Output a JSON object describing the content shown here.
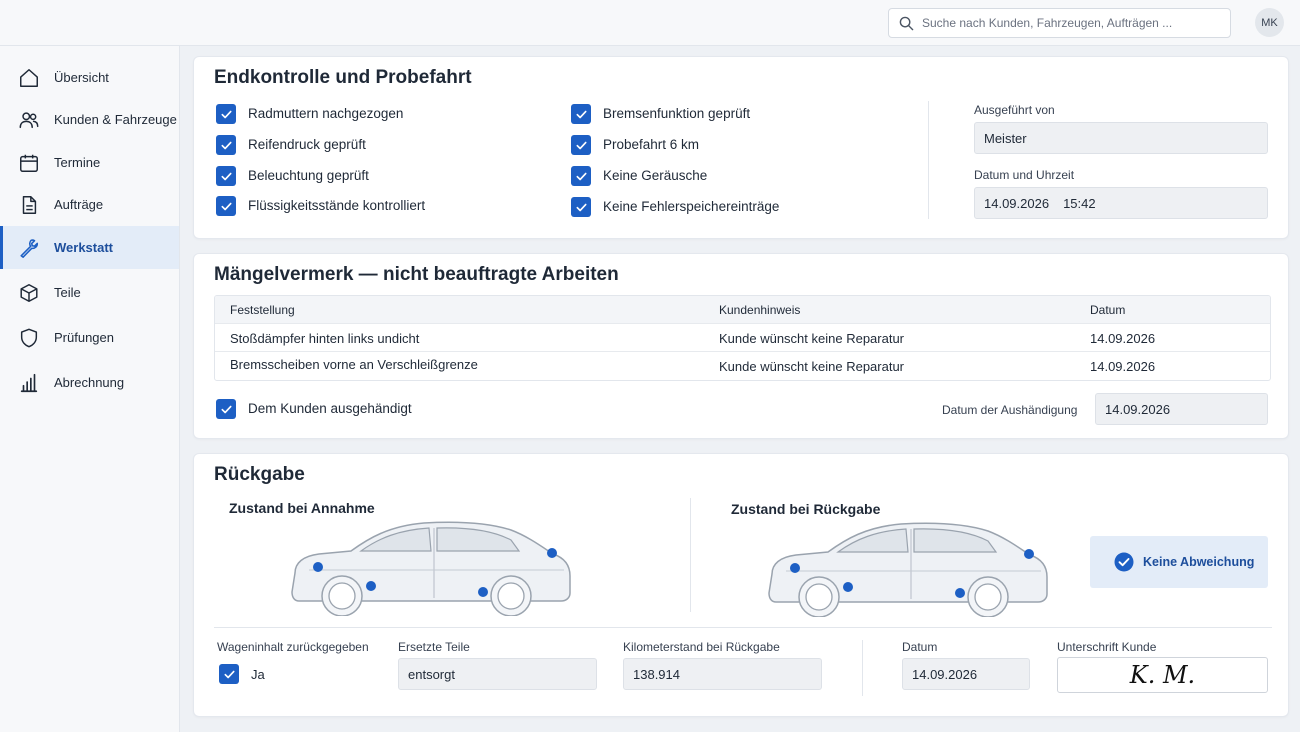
{
  "header": {
    "search_placeholder": "Suche nach Kunden, Fahrzeugen, Aufträgen ...",
    "avatar_initials": "MK"
  },
  "sidebar": {
    "items": [
      {
        "label": "Übersicht",
        "icon": "home-icon"
      },
      {
        "label": "Kunden & Fahrzeuge",
        "icon": "users-icon"
      },
      {
        "label": "Termine",
        "icon": "calendar-icon"
      },
      {
        "label": "Aufträge",
        "icon": "document-icon"
      },
      {
        "label": "Werkstatt",
        "icon": "wrench-icon",
        "active": true
      },
      {
        "label": "Teile",
        "icon": "box-icon"
      },
      {
        "label": "Prüfungen",
        "icon": "shield-icon"
      },
      {
        "label": "Abrechnung",
        "icon": "bar-chart-icon"
      }
    ]
  },
  "endkontrolle": {
    "title": "Endkontrolle und Probefahrt",
    "checks_left": [
      "Radmuttern nachgezogen",
      "Reifendruck geprüft",
      "Beleuchtung geprüft",
      "Flüssigkeitsstände kontrolliert"
    ],
    "checks_right": [
      "Bremsenfunktion geprüft",
      "Probefahrt 6 km",
      "Keine Geräusche",
      "Keine Fehlerspeichereinträge"
    ],
    "executed_by_label": "Ausgeführt von",
    "executed_by_value": "Meister",
    "datetime_label": "Datum und Uhrzeit",
    "date_value": "14.09.2026",
    "time_value": "15:42"
  },
  "maengel": {
    "title": "Mängelvermerk — nicht beauftragte Arbeiten",
    "columns": [
      "Feststellung",
      "Kundenhinweis",
      "Datum"
    ],
    "rows": [
      [
        "Stoßdämpfer hinten links undicht",
        "Kunde wünscht keine Reparatur",
        "14.09.2026"
      ],
      [
        "Bremsscheiben vorne an Verschleißgrenze",
        "Kunde wünscht keine Reparatur",
        "14.09.2026"
      ]
    ],
    "handed_label": "Dem Kunden ausgehändigt",
    "handed_date_label": "Datum der Aushändigung",
    "handed_date_value": "14.09.2026"
  },
  "rueckgabe": {
    "title": "Rückgabe",
    "intake_title": "Zustand bei Annahme",
    "return_title": "Zustand bei Rückgabe",
    "status": "Keine Abweichung",
    "contents_label": "Wageninhalt zurückgegeben",
    "contents_value": "Ja",
    "parts_label": "Ersetzte Teile",
    "parts_value": "entsorgt",
    "mileage_label": "Kilometerstand bei Rückgabe",
    "mileage_value": "138.914",
    "date_label": "Datum",
    "date_value": "14.09.2026",
    "signature_label": "Unterschrift Kunde",
    "signature": "K. M."
  },
  "colors": {
    "accent": "#1d5fc4",
    "active_bg": "#e3ecf8",
    "background": "#eef1f5"
  }
}
